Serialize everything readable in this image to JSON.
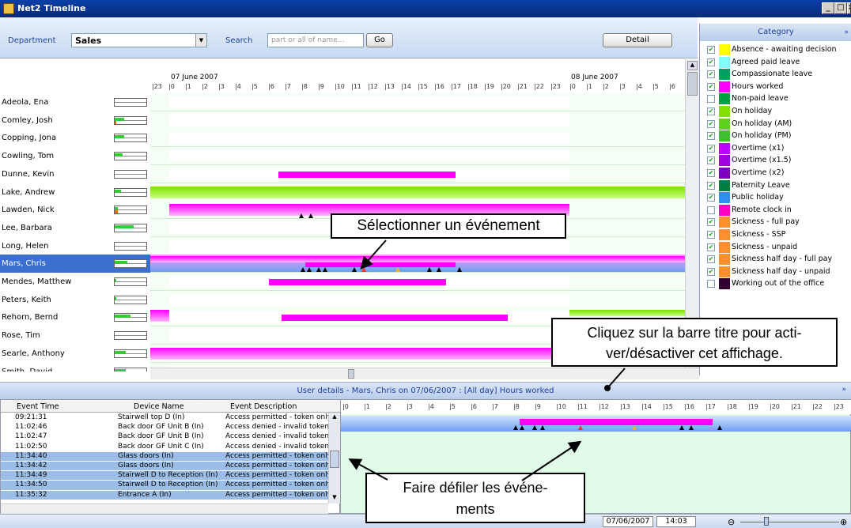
{
  "window": {
    "title": "Net2 Timeline",
    "buttons": [
      "_",
      "□",
      "×"
    ]
  },
  "toolbar": {
    "department_label": "Department",
    "department_value": "Sales",
    "search_label": "Search",
    "search_placeholder": "part or all of name...",
    "go_label": "Go",
    "detail_label": "Detail"
  },
  "timeline": {
    "date1": "07 June 2007",
    "date2": "08 June 2007",
    "hours1": [
      "23",
      "0",
      "1",
      "2",
      "3",
      "4",
      "5",
      "6",
      "7",
      "8",
      "9",
      "10",
      "11",
      "12",
      "13",
      "14",
      "15",
      "16",
      "17",
      "18",
      "19",
      "20",
      "21",
      "22",
      "23"
    ],
    "hours2": [
      "0",
      "1",
      "2",
      "3",
      "4",
      "5",
      "6"
    ]
  },
  "people": [
    {
      "name": "Adeola, Ena",
      "green": 0,
      "orange": 0
    },
    {
      "name": "Comley, Josh",
      "green": 0.3,
      "orange": 0.05
    },
    {
      "name": "Copping, Jona",
      "green": 0.3,
      "orange": 0
    },
    {
      "name": "Cowling, Tom",
      "green": 0.25,
      "orange": 0
    },
    {
      "name": "Dunne, Kevin",
      "green": 0,
      "orange": 0
    },
    {
      "name": "Lake, Andrew",
      "green": 0.2,
      "orange": 0
    },
    {
      "name": "Lawden, Nick",
      "green": 0.1,
      "orange": 0.1
    },
    {
      "name": "Lee, Barbara",
      "green": 0.6,
      "orange": 0
    },
    {
      "name": "Long, Helen",
      "green": 0,
      "orange": 0
    },
    {
      "name": "Mars, Chris",
      "green": 0.4,
      "orange": 0,
      "selected": true
    },
    {
      "name": "Mendes, Matthew",
      "green": 0.05,
      "orange": 0
    },
    {
      "name": "Peters, Keith",
      "green": 0.05,
      "orange": 0
    },
    {
      "name": "Rehorn, Bernd",
      "green": 0.5,
      "orange": 0
    },
    {
      "name": "Rose, Tim",
      "green": 0,
      "orange": 0
    },
    {
      "name": "Searle, Anthony",
      "green": 0.35,
      "orange": 0
    },
    {
      "name": "Smith, David",
      "green": 0.35,
      "orange": 0
    }
  ],
  "categories": {
    "header": "Category",
    "items": [
      {
        "label": "Absence - awaiting decision",
        "color": "#ffff00",
        "checked": true
      },
      {
        "label": "Agreed paid leave",
        "color": "#80ffff",
        "checked": true
      },
      {
        "label": "Compassionate leave",
        "color": "#00a060",
        "checked": true
      },
      {
        "label": "Hours worked",
        "color": "#ff00ff",
        "checked": true
      },
      {
        "label": "Non-paid leave",
        "color": "#00a040",
        "checked": false
      },
      {
        "label": "On holiday",
        "color": "#80e000",
        "checked": true
      },
      {
        "label": "On holiday (AM)",
        "color": "#60d020",
        "checked": true
      },
      {
        "label": "On holiday (PM)",
        "color": "#40c030",
        "checked": true
      },
      {
        "label": "Overtime (x1)",
        "color": "#c000ff",
        "checked": true
      },
      {
        "label": "Overtime (x1.5)",
        "color": "#a000e0",
        "checked": true
      },
      {
        "label": "Overtime (x2)",
        "color": "#8000c0",
        "checked": true
      },
      {
        "label": "Paternity Leave",
        "color": "#008040",
        "checked": true
      },
      {
        "label": "Public holiday",
        "color": "#3090f0",
        "checked": true
      },
      {
        "label": "Remote clock in",
        "color": "#ff00c0",
        "checked": false
      },
      {
        "label": "Sickness - full pay",
        "color": "#ff9030",
        "checked": true
      },
      {
        "label": "Sickness - SSP",
        "color": "#ff9030",
        "checked": true
      },
      {
        "label": "Sickness - unpaid",
        "color": "#ff9030",
        "checked": true
      },
      {
        "label": "Sickness half day - full pay",
        "color": "#ff9030",
        "checked": true
      },
      {
        "label": "Sickness half day - unpaid",
        "color": "#ff9030",
        "checked": true
      },
      {
        "label": "Working out of the office",
        "color": "#300030",
        "checked": false
      }
    ]
  },
  "detail": {
    "title": "User details - Mars, Chris on 07/06/2007 : [All day]  Hours worked",
    "columns": [
      "Event Time",
      "Device Name",
      "Event Description"
    ],
    "hours": [
      "0",
      "1",
      "2",
      "3",
      "4",
      "5",
      "6",
      "7",
      "8",
      "9",
      "10",
      "11",
      "12",
      "13",
      "14",
      "15",
      "16",
      "17",
      "18",
      "19",
      "20",
      "21",
      "22",
      "23"
    ],
    "events": [
      {
        "time": "09:21:31",
        "device": "Stairwell top D (In)",
        "desc": "Access permitted - token only",
        "sel": false
      },
      {
        "time": "11:02:46",
        "device": "Back door GF Unit B (In)",
        "desc": "Access denied - invalid token",
        "sel": false
      },
      {
        "time": "11:02:47",
        "device": "Back door GF Unit B (In)",
        "desc": "Access denied - invalid token",
        "sel": false
      },
      {
        "time": "11:02:50",
        "device": "Back door GF Unit C (In)",
        "desc": "Access denied - invalid token",
        "sel": false
      },
      {
        "time": "11:34:40",
        "device": "Glass doors (In)",
        "desc": "Access permitted - token only",
        "sel": true
      },
      {
        "time": "11:34:42",
        "device": "Glass doors (In)",
        "desc": "Access permitted - token only",
        "sel": true
      },
      {
        "time": "11:34:49",
        "device": "Stairwell D to Reception (In)",
        "desc": "Access permitted - token only",
        "sel": true
      },
      {
        "time": "11:34:50",
        "device": "Stairwell D to Reception (In)",
        "desc": "Access permitted - token only",
        "sel": true
      },
      {
        "time": "11:35:32",
        "device": "Entrance A (In)",
        "desc": "Access permitted - token only",
        "sel": true
      }
    ]
  },
  "status": {
    "date": "07/06/2007",
    "time": "14:03"
  },
  "callouts": {
    "select_event": "Sélectionner un événement",
    "toggle_view": "Cliquez sur la barre titre pour acti-ver/désactiver cet affichage.",
    "scroll_events": "Faire défiler les événe-ments"
  },
  "colors": {
    "hours_worked": "#ff00ff",
    "holiday": "#80e000",
    "selection": "#3a6fd0"
  }
}
